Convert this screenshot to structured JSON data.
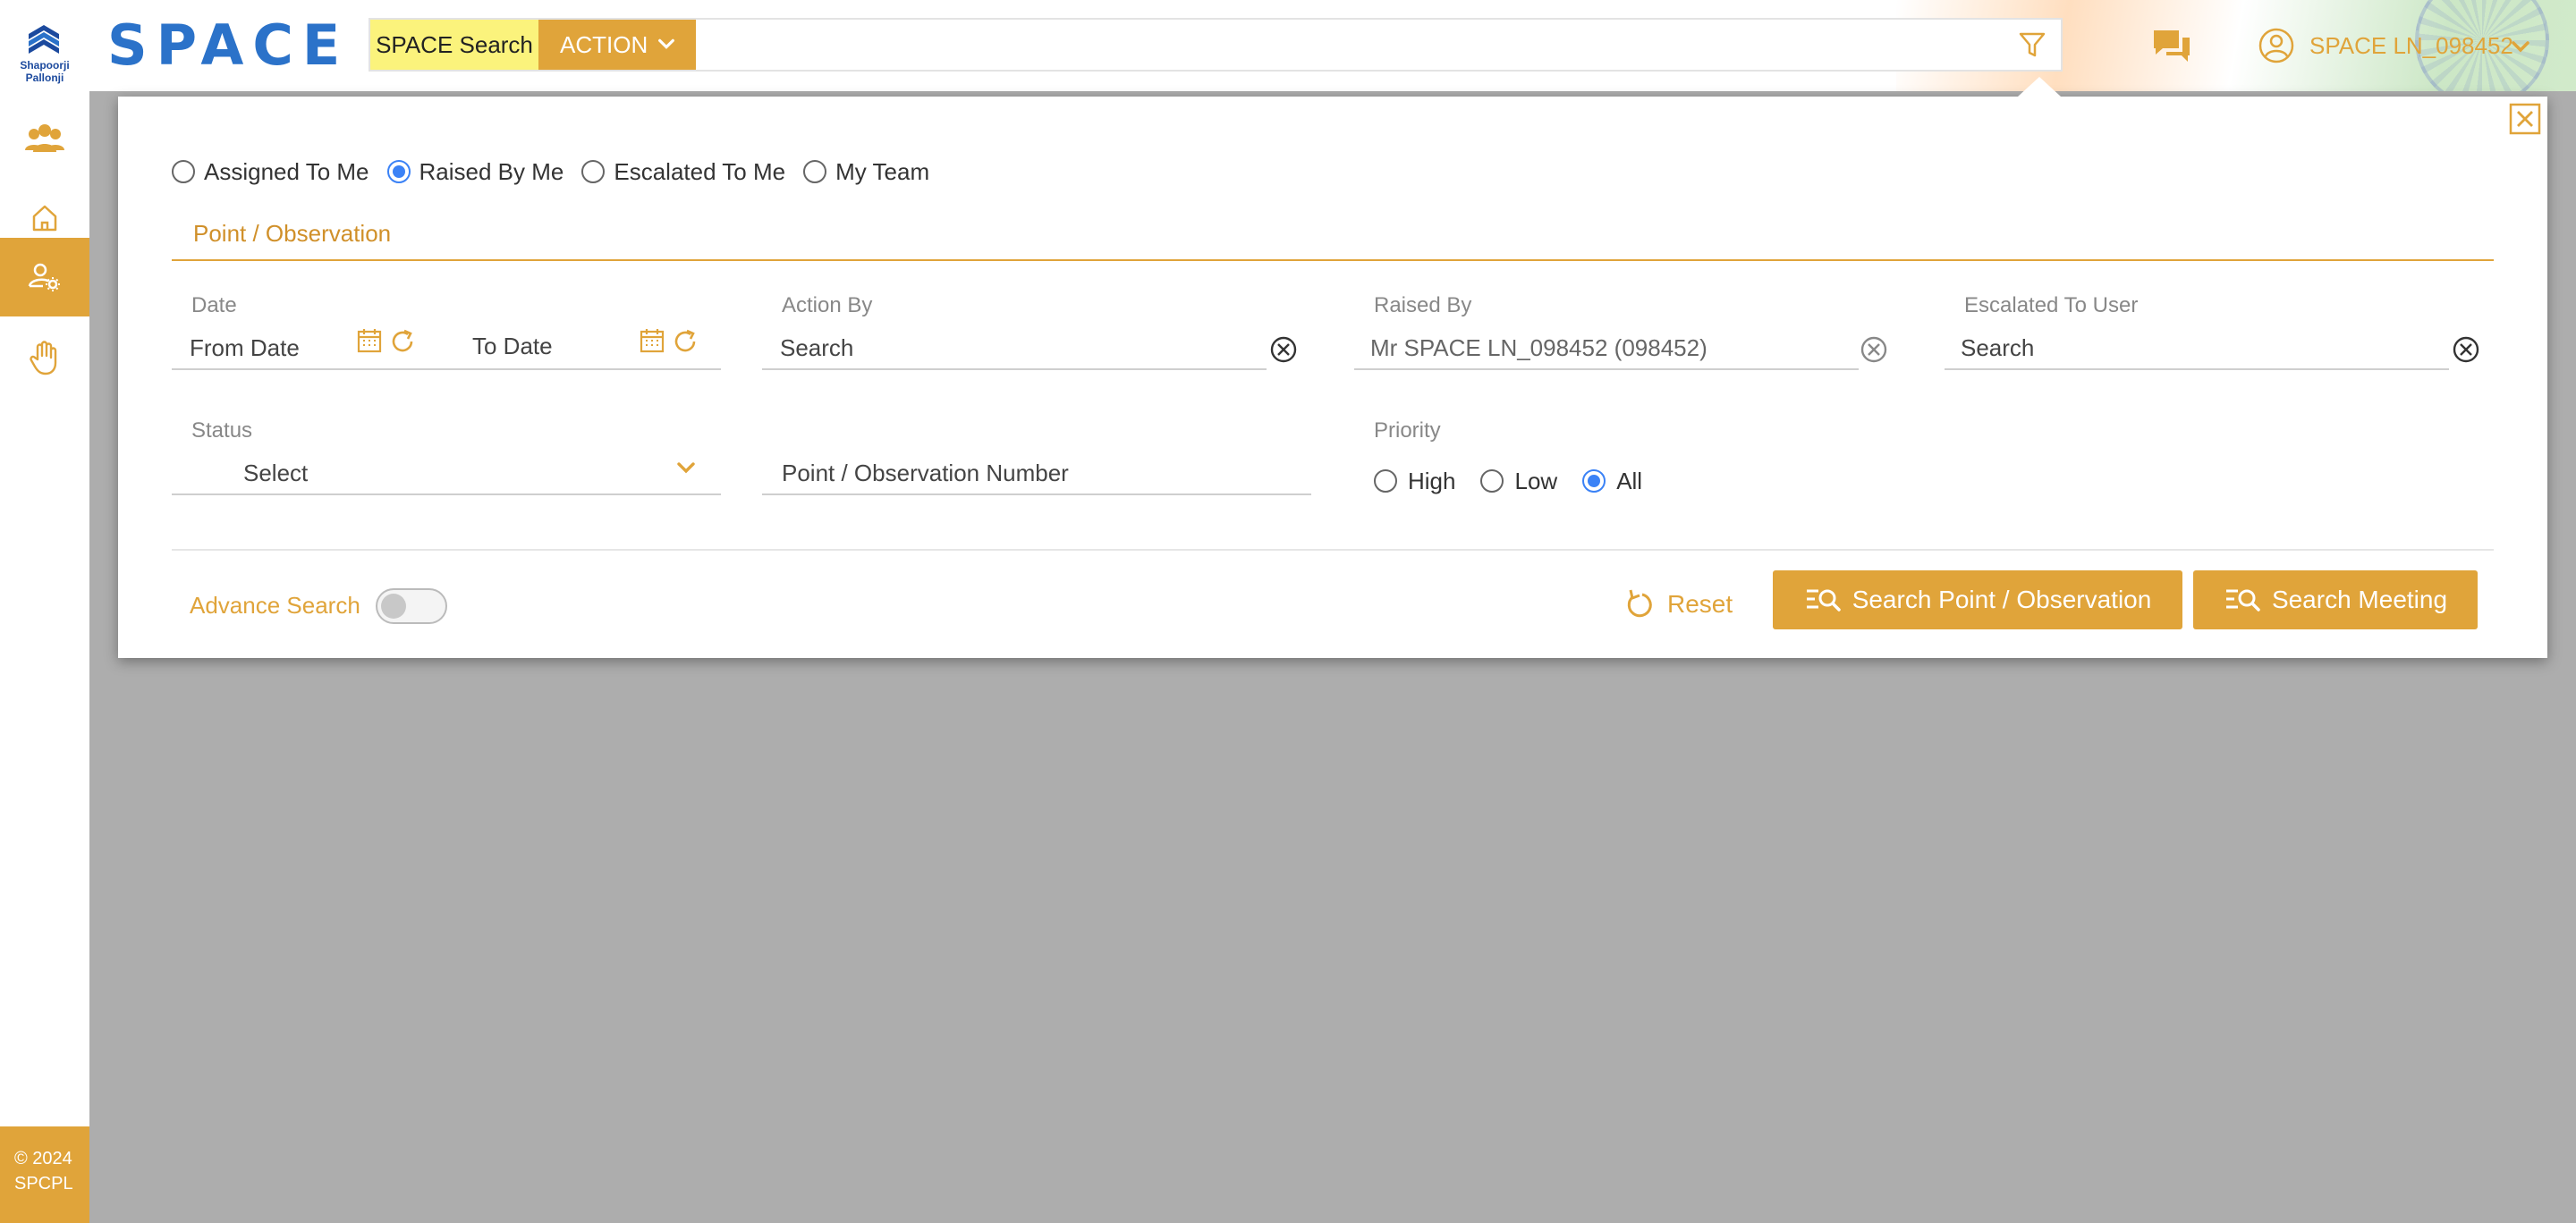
{
  "brand": {
    "company_logo_text": "Shapoorji Pallonji",
    "app_logo_text": "SPACE",
    "colors": {
      "accent": "#e0a43a",
      "logo_blue": "#2b72c9",
      "radio_selected": "#3b82f6"
    }
  },
  "header": {
    "search_label": "SPACE Search",
    "search_module": "ACTION",
    "search_value": "",
    "user_name": "SPACE LN_098452"
  },
  "sidebar": {
    "items": [
      {
        "icon": "team-icon",
        "active": false
      },
      {
        "icon": "home-icon",
        "active": false
      },
      {
        "icon": "user-settings-icon",
        "active": true
      },
      {
        "icon": "hand-icon",
        "active": false
      }
    ],
    "copyright_line1": "© 2024",
    "copyright_line2": "SPCPL"
  },
  "modal": {
    "scope_options": [
      {
        "label": "Assigned To Me",
        "selected": false
      },
      {
        "label": "Raised By Me",
        "selected": true
      },
      {
        "label": "Escalated To Me",
        "selected": false
      },
      {
        "label": "My Team",
        "selected": false
      }
    ],
    "tab_title": "Point / Observation",
    "date": {
      "label": "Date",
      "from_placeholder": "From Date",
      "to_placeholder": "To Date"
    },
    "action_by": {
      "label": "Action By",
      "value": "Search"
    },
    "raised_by": {
      "label": "Raised By",
      "value": "Mr SPACE LN_098452  (098452)"
    },
    "escalated_to": {
      "label": "Escalated To User",
      "value": "Search"
    },
    "status": {
      "label": "Status",
      "value": "Select"
    },
    "point_number": {
      "placeholder": "Point / Observation Number"
    },
    "priority": {
      "label": "Priority",
      "options": [
        {
          "label": "High",
          "selected": false
        },
        {
          "label": "Low",
          "selected": false
        },
        {
          "label": "All",
          "selected": true
        }
      ]
    },
    "advance_search_label": "Advance Search",
    "advance_search_on": false,
    "reset_label": "Reset",
    "search_point_label": "Search Point / Observation",
    "search_meeting_label": "Search Meeting"
  }
}
